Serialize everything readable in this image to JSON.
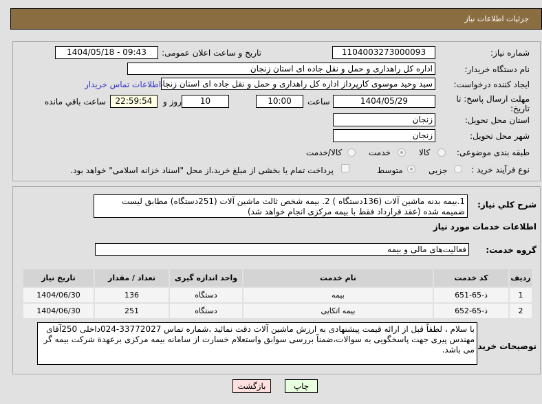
{
  "header": {
    "title": "جزئیات اطلاعات نیاز"
  },
  "form": {
    "need_number_label": "شماره نیاز:",
    "need_number": "1104003273000093",
    "announce_label": "تاریخ و ساعت اعلان عمومی:",
    "announce_value": "1404/05/18 - 09:43",
    "buyer_org_label": "نام دستگاه خریدار:",
    "buyer_org": "اداره کل راهداری و حمل و نقل جاده ای استان زنجان",
    "creator_label": "ایجاد کننده درخواست:",
    "creator": "سید وحید موسوی کارپرداز اداره کل راهداری و حمل و نقل جاده ای استان زنجان",
    "contact_link": "اطلاعات تماس خریدار",
    "deadline_label": "مهلت ارسال پاسخ: تا تاریخ:",
    "deadline_date": "1404/05/29",
    "time_label": "ساعت",
    "deadline_time": "10:00",
    "days": "10",
    "days_label": "روز و",
    "remaining": "22:59:54",
    "remaining_label": "ساعت باقي مانده",
    "province_label": "استان محل تحویل:",
    "province": "زنجان",
    "city_label": "شهر محل تحویل:",
    "city": "زنجان",
    "category_label": "طبقه بندی موضوعی:",
    "category_options": [
      "كالا",
      "خدمت",
      "كالا/خدمت"
    ],
    "category_selected": "خدمت",
    "process_label": "نوع فرآیند خرید :",
    "process_options": [
      "جزیی",
      "متوسط"
    ],
    "process_selected": "متوسط",
    "payment_note": "پرداخت تمام یا بخشی از مبلغ خرید،از محل \"اسناد خزانه اسلامی\" خواهد بود."
  },
  "details": {
    "desc_label": "شرح کلي نياز:",
    "desc": "1.بیمه بدنه ماشین آلات (136دستگاه ) 2. بیمه شخص ثالث ماشین آلات (251دستگاه) مطابق لیست ضمیمه شده (عقد قرارداد فقط با بیمه مرکزی انجام خواهد شد)",
    "services_title": "اطلاعات خدمات مورد نیاز",
    "group_label": "گروه خدمت:",
    "group": "فعالیت‌های مالی و بیمه",
    "table": {
      "headers": [
        "ردیف",
        "کد خدمت",
        "نام خدمت",
        "واحد اندازه گیری",
        "تعداد / مقدار",
        "تاریخ نیاز"
      ],
      "rows": [
        [
          "1",
          "ذ-65-651",
          "بیمه",
          "دستگاه",
          "136",
          "1404/06/30"
        ],
        [
          "2",
          "ذ-65-652",
          "بیمه اتکایی",
          "دستگاه",
          "251",
          "1404/06/30"
        ]
      ]
    },
    "notes_label": "توضیحات خریدار:",
    "notes": "با سلام ، لطفاً قبل از ارائه قیمت پیشنهادی به ارزش ماشین آلات دقت نمائید ،شماره تماس 33772027-024داخلی 250آقای مهندس پیری جهت پاسخگویی به سوالات،ضمناً بررسی سوابق واستعلام خسارت از سامانه بیمه مرکزی برعهدة شرکت بیمه گر می باشد."
  },
  "buttons": {
    "print": "چاپ",
    "back": "بازگشت"
  },
  "colors": {
    "header": "#8b6d42",
    "link": "#3333cc",
    "print_bg": "#e8ffe0",
    "back_bg": "#ffe0e0"
  }
}
